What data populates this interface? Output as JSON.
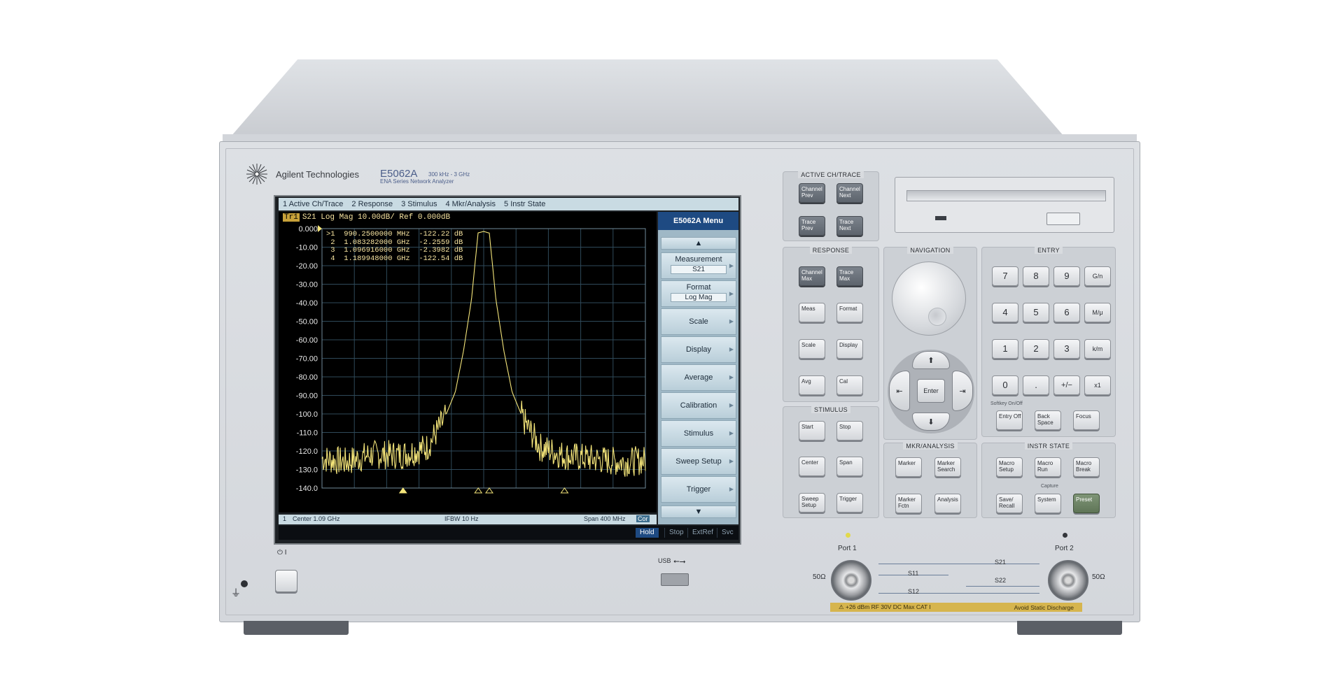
{
  "brand": {
    "name": "Agilent Technologies",
    "model": "E5062A",
    "range": "300 kHz - 3 GHz",
    "series": "ENA Series Network Analyzer"
  },
  "screen": {
    "menu": [
      "1 Active Ch/Trace",
      "2 Response",
      "3 Stimulus",
      "4 Mkr/Analysis",
      "5 Instr State"
    ],
    "trace_tag": "Tr1",
    "trace_header": "S21  Log Mag 10.00dB/ Ref 0.000dB",
    "y_ticks": [
      "0.000",
      "-10.00",
      "-20.00",
      "-30.00",
      "-40.00",
      "-50.00",
      "-60.00",
      "-70.00",
      "-80.00",
      "-90.00",
      "-100.0",
      "-110.0",
      "-120.0",
      "-130.0",
      "-140.0"
    ],
    "markers": [
      {
        "id": ">1",
        "freq": "990.2500000 MHz",
        "value": "-122.22 dB"
      },
      {
        "id": "2",
        "freq": "1.083282000 GHz",
        "value": "-2.2559 dB"
      },
      {
        "id": "3",
        "freq": "1.096916000 GHz",
        "value": "-2.3982 dB"
      },
      {
        "id": "4",
        "freq": "1.189948000 GHz",
        "value": "-122.54 dB"
      }
    ],
    "status": {
      "channel": "1",
      "center": "Center 1.09 GHz",
      "ifbw": "IFBW 10 Hz",
      "span": "Span 400 MHz",
      "cor": "Cor"
    },
    "bottom_buttons": [
      "Hold",
      "Stop",
      "ExtRef",
      "Svc"
    ],
    "softkeys": {
      "title": "E5062A Menu",
      "items": [
        {
          "label": "Measurement",
          "value": "S21"
        },
        {
          "label": "Format",
          "value": "Log Mag"
        },
        {
          "label": "Scale"
        },
        {
          "label": "Display"
        },
        {
          "label": "Average"
        },
        {
          "label": "Calibration"
        },
        {
          "label": "Stimulus"
        },
        {
          "label": "Sweep Setup"
        },
        {
          "label": "Trigger"
        }
      ]
    }
  },
  "chart_data": {
    "type": "line",
    "title": "S21 Log Mag 10.00dB/ Ref 0.000dB",
    "xlabel": "",
    "ylabel": "",
    "x_unit": "GHz",
    "xlim": [
      0.89,
      1.29
    ],
    "ylim": [
      -140,
      0
    ],
    "grid": true,
    "series": [
      {
        "name": "S21",
        "x": [
          0.89,
          0.92,
          0.95,
          0.99,
          1.02,
          1.04,
          1.055,
          1.065,
          1.075,
          1.083,
          1.09,
          1.097,
          1.105,
          1.115,
          1.125,
          1.14,
          1.16,
          1.19,
          1.22,
          1.26,
          1.29
        ],
        "values": [
          -124,
          -126,
          -122,
          -122,
          -118,
          -104,
          -88,
          -66,
          -38,
          -2.3,
          -1.5,
          -2.4,
          -38,
          -66,
          -88,
          -104,
          -118,
          -122.5,
          -124,
          -126,
          -125
        ]
      }
    ],
    "marker_points": [
      {
        "x": 0.99025,
        "y": -122.22
      },
      {
        "x": 1.083282,
        "y": -2.2559
      },
      {
        "x": 1.096916,
        "y": -2.3982
      },
      {
        "x": 1.189948,
        "y": -122.54
      }
    ]
  },
  "front_panel": {
    "active_ch": {
      "title": "ACTIVE CH/TRACE",
      "keys": [
        "Channel Prev",
        "Channel Next",
        "Trace Prev",
        "Trace Next"
      ]
    },
    "response": {
      "title": "RESPONSE",
      "keys": [
        "Channel Max",
        "Trace Max",
        "Meas",
        "Format",
        "Scale",
        "Display",
        "Avg",
        "Cal"
      ]
    },
    "stimulus": {
      "title": "STIMULUS",
      "keys": [
        "Start",
        "Stop",
        "Center",
        "Span",
        "Sweep Setup",
        "Trigger"
      ]
    },
    "navigation": {
      "title": "NAVIGATION",
      "enter": "Enter"
    },
    "mkr": {
      "title": "MKR/ANALYSIS",
      "keys": [
        "Marker",
        "Marker Search",
        "Marker Fctn",
        "Analysis"
      ]
    },
    "entry": {
      "title": "ENTRY",
      "keys": [
        "7",
        "8",
        "9",
        "G/n",
        "4",
        "5",
        "6",
        "M/μ",
        "1",
        "2",
        "3",
        "k/m",
        "0",
        ".",
        "+/−",
        "x1"
      ],
      "note": "Softkey On/Off",
      "bottom": [
        "Entry Off",
        "Back Space",
        "Focus"
      ]
    },
    "instr": {
      "title": "INSTR STATE",
      "keys": [
        "Macro Setup",
        "Macro Run",
        "Macro Break",
        "Save/ Recall",
        "System",
        "Preset"
      ],
      "note": "Capture"
    },
    "ports": {
      "port1": "Port 1",
      "port2": "Port 2",
      "ohm": "50Ω",
      "s21": "S21",
      "s11": "S11",
      "s22": "S22",
      "s12": "S12"
    },
    "warning": {
      "left": "⚠ +26 dBm RF 30V DC Max CAT I",
      "right": "Avoid Static Discharge"
    },
    "usb": "USB",
    "power": "⏻ I"
  }
}
